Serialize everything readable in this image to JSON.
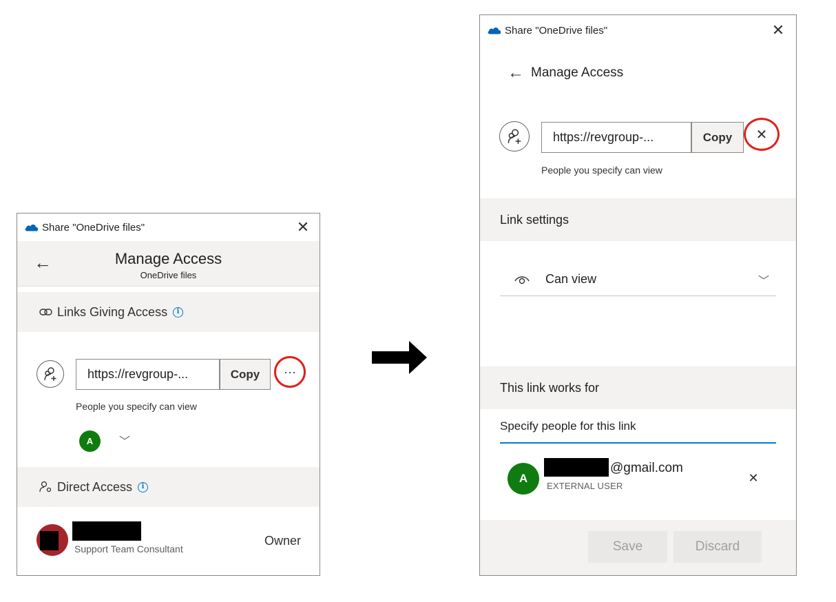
{
  "left_dialog": {
    "title": "Share \"OneDrive files\"",
    "close_glyph": "✕",
    "header": {
      "title": "Manage Access",
      "subtitle": "OneDrive files"
    },
    "links_section": {
      "label": "Links Giving Access",
      "icon": "link-icon",
      "info": "i"
    },
    "link": {
      "url_text": "https://revgroup-...",
      "copy_label": "Copy",
      "more_glyph": "···",
      "permission_text": "People you specify can view",
      "avatar_initial": "A"
    },
    "direct_section": {
      "label": "Direct Access",
      "icon": "people-settings-icon",
      "info": "i"
    },
    "owner": {
      "role_text": "Support Team Consultant",
      "permission": "Owner"
    }
  },
  "right_dialog": {
    "title": "Share \"OneDrive files\"",
    "close_glyph": "✕",
    "back_label": "Manage Access",
    "link": {
      "url_text": "https://revgroup-...",
      "copy_label": "Copy",
      "delete_glyph": "✕",
      "permission_text": "People you specify can view"
    },
    "link_settings": {
      "heading": "Link settings",
      "dropdown_value": "Can view",
      "dropdown_icon": "eye-icon"
    },
    "works_for": {
      "heading": "This link works for",
      "input_value": "Specify people for this link"
    },
    "external_user": {
      "avatar_initial": "A",
      "email_suffix": "@gmail.com",
      "role": "EXTERNAL USER",
      "remove_glyph": "✕"
    },
    "footer": {
      "save_label": "Save",
      "discard_label": "Discard"
    }
  },
  "colors": {
    "accent": "#0078d4",
    "highlight_ring": "#e0201b",
    "avatar_green": "#107c10",
    "owner_avatar": "#a4262c",
    "section_bg": "#f3f2f1"
  }
}
